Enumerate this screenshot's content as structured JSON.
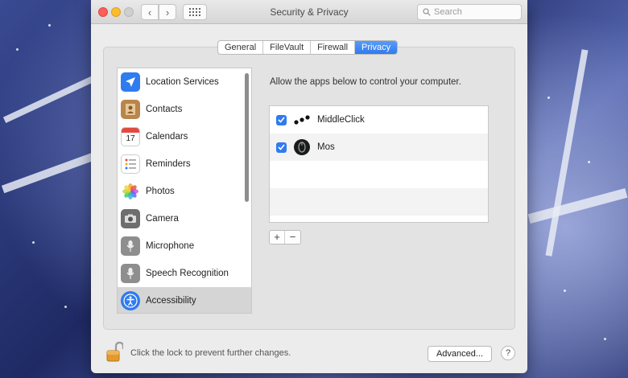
{
  "window": {
    "title": "Security & Privacy",
    "search_placeholder": "Search"
  },
  "tabs": [
    {
      "label": "General"
    },
    {
      "label": "FileVault"
    },
    {
      "label": "Firewall"
    },
    {
      "label": "Privacy",
      "active": true
    }
  ],
  "sidebar": {
    "items": [
      {
        "label": "Location Services",
        "icon": "location-arrow-icon"
      },
      {
        "label": "Contacts",
        "icon": "contacts-book-icon"
      },
      {
        "label": "Calendars",
        "icon": "calendar-icon",
        "icon_text": "17"
      },
      {
        "label": "Reminders",
        "icon": "reminders-list-icon"
      },
      {
        "label": "Photos",
        "icon": "photos-flower-icon"
      },
      {
        "label": "Camera",
        "icon": "camera-icon"
      },
      {
        "label": "Microphone",
        "icon": "microphone-icon"
      },
      {
        "label": "Speech Recognition",
        "icon": "speech-recognition-icon"
      },
      {
        "label": "Accessibility",
        "icon": "accessibility-icon",
        "selected": true
      }
    ]
  },
  "main": {
    "description": "Allow the apps below to control your computer.",
    "apps": [
      {
        "name": "MiddleClick",
        "checked": true,
        "icon": "middleclick-dots-icon"
      },
      {
        "name": "Mos",
        "checked": true,
        "icon": "mos-mouse-icon"
      }
    ],
    "add_label": "+",
    "remove_label": "−"
  },
  "footer": {
    "lock_text": "Click the lock to prevent further changes.",
    "advanced_label": "Advanced...",
    "help_label": "?"
  },
  "colors": {
    "accent": "#2f7bef",
    "close": "#fc5f57",
    "minimize": "#fdbc2e"
  }
}
